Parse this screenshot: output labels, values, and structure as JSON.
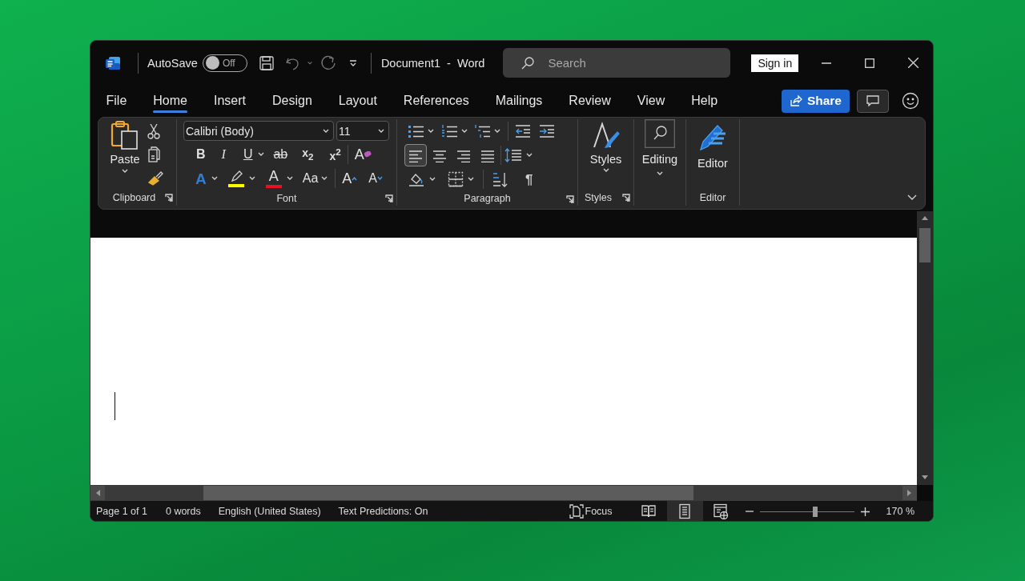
{
  "title_bar": {
    "autosave": {
      "label": "AutoSave",
      "on": false,
      "state": "Off"
    },
    "document_title": "Document1  -  Word",
    "search": {
      "placeholder": "Search"
    },
    "sign_in": "Sign in"
  },
  "tabs": [
    {
      "label": "File",
      "selected": false
    },
    {
      "label": "Home",
      "selected": true
    },
    {
      "label": "Insert",
      "selected": false
    },
    {
      "label": "Design",
      "selected": false
    },
    {
      "label": "Layout",
      "selected": false
    },
    {
      "label": "References",
      "selected": false
    },
    {
      "label": "Mailings",
      "selected": false
    },
    {
      "label": "Review",
      "selected": false
    },
    {
      "label": "View",
      "selected": false
    },
    {
      "label": "Help",
      "selected": false
    }
  ],
  "share_button": "Share",
  "ribbon": {
    "clipboard": {
      "paste": "Paste",
      "label": "Clipboard"
    },
    "font": {
      "name": "Calibri (Body)",
      "size": "11",
      "label": "Font",
      "row_1": [
        {
          "kind": "bold",
          "text": "B"
        },
        {
          "kind": "italic",
          "text": "I"
        },
        {
          "kind": "underline",
          "text": "U"
        },
        {
          "kind": "strikethrough",
          "text": "ab"
        },
        {
          "kind": "subscript",
          "text": "x$_{2}$"
        },
        {
          "kind": "superscript",
          "text": "x$^{2}$"
        },
        {
          "kind": "clear",
          "text": "A"
        }
      ],
      "row_2": [
        {
          "kind": "effects",
          "text": "A"
        },
        {
          "kind": "highlight",
          "color": "#ffff00"
        },
        {
          "kind": "font_color",
          "text": "A",
          "color": "#e81123"
        },
        {
          "kind": "case",
          "text": "Aa"
        },
        {
          "kind": "grow",
          "text": "A"
        },
        {
          "kind": "shrink",
          "text": "A"
        }
      ]
    },
    "paragraph": {
      "label": "Paragraph",
      "pilcrow": "¶",
      "alignment": [
        {
          "kind": "left",
          "selected": true
        },
        {
          "kind": "center",
          "selected": false
        },
        {
          "kind": "right",
          "selected": false
        },
        {
          "kind": "justify",
          "selected": false
        }
      ]
    },
    "styles": {
      "button": "Styles",
      "label": "Styles"
    },
    "editing": {
      "button": "Editing"
    },
    "editor": {
      "button": "Editor",
      "label": "Editor"
    }
  },
  "status_bar": {
    "page": "Page 1 of 1",
    "words": "0 words",
    "language": "English (United States)",
    "predictions": "Text Predictions: On",
    "focus": "Focus",
    "views": [
      {
        "kind": "read",
        "selected": false
      },
      {
        "kind": "print",
        "selected": true
      },
      {
        "kind": "web",
        "selected": false
      }
    ],
    "zoom": {
      "level": 0.59,
      "reading": "170 %"
    }
  }
}
